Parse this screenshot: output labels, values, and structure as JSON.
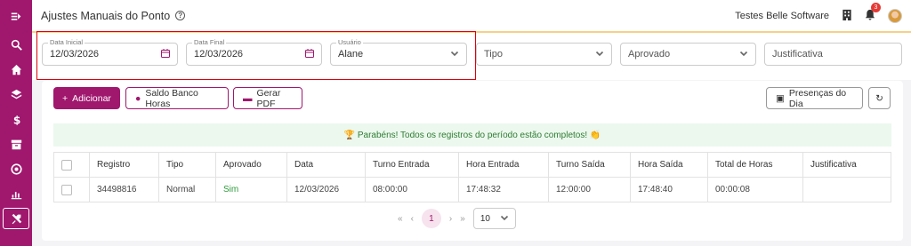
{
  "sidebar": {
    "icons": [
      "menu-collapse-icon",
      "search-icon",
      "home-icon",
      "layers-icon",
      "dollar-icon",
      "archive-icon",
      "target-icon",
      "chart-icon",
      "tools-icon"
    ]
  },
  "header": {
    "title": "Ajustes Manuais do Ponto",
    "help": "?",
    "company": "Testes Belle Software",
    "notifications_count": "3"
  },
  "filters": {
    "data_inicial": {
      "label": "Data Inicial",
      "value": "12/03/2026"
    },
    "data_final": {
      "label": "Data Final",
      "value": "12/03/2026"
    },
    "usuario": {
      "label": "Usuário",
      "value": "Alane"
    },
    "tipo": {
      "placeholder": "Tipo"
    },
    "aprovado": {
      "placeholder": "Aprovado"
    },
    "justificativa": {
      "placeholder": "Justificativa"
    }
  },
  "toolbar": {
    "adicionar": "Adicionar",
    "saldo": "Saldo Banco Horas",
    "gerar_pdf": "Gerar PDF",
    "presencas": "Presenças do Dia"
  },
  "notice": "🏆 Parabéns! Todos os registros do período estão completos! 👏",
  "table": {
    "headers": [
      "Registro",
      "Tipo",
      "Aprovado",
      "Data",
      "Turno Entrada",
      "Hora Entrada",
      "Turno Saída",
      "Hora Saída",
      "Total de Horas",
      "Justificativa"
    ],
    "rows": [
      [
        "34498816",
        "Normal",
        "Sim",
        "12/03/2026",
        "08:00:00",
        "17:48:32",
        "12:00:00",
        "17:48:40",
        "00:00:08",
        ""
      ]
    ]
  },
  "pagination": {
    "first": "«",
    "prev": "‹",
    "current": "1",
    "next": "›",
    "last": "»",
    "page_size": "10"
  },
  "colors": {
    "brand": "#a0176e",
    "success": "#2e9a3a",
    "highlight": "#e0000a"
  }
}
